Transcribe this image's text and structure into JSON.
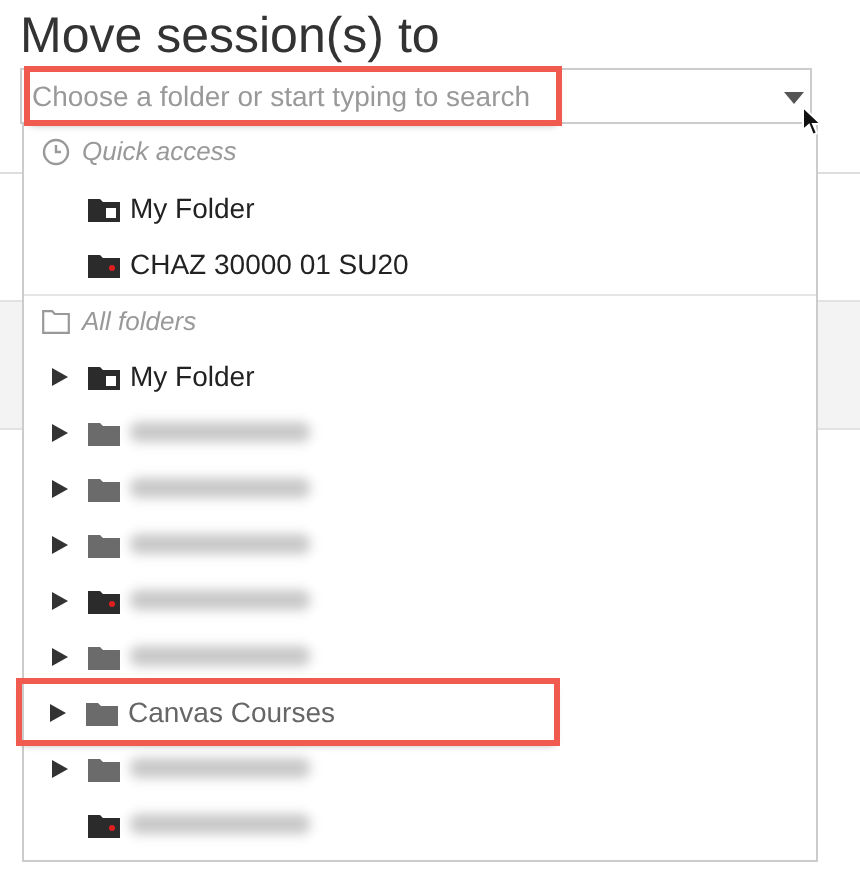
{
  "title": "Move session(s) to",
  "search": {
    "placeholder": "Choose a folder or start typing to search",
    "highlighted": true
  },
  "quick_access": {
    "heading": "Quick access",
    "items": [
      {
        "label": "My Folder",
        "kind": "personal"
      },
      {
        "label": "CHAZ 30000 01 SU20",
        "kind": "course"
      }
    ]
  },
  "all_folders": {
    "heading": "All folders",
    "items": [
      {
        "label": "My Folder",
        "kind": "personal",
        "expandable": true,
        "blurred": false,
        "highlighted": false
      },
      {
        "kind": "plain",
        "expandable": true,
        "blurred": true,
        "highlighted": false
      },
      {
        "kind": "plain",
        "expandable": true,
        "blurred": true,
        "highlighted": false
      },
      {
        "kind": "plain",
        "expandable": true,
        "blurred": true,
        "highlighted": false
      },
      {
        "kind": "course",
        "expandable": true,
        "blurred": true,
        "highlighted": false
      },
      {
        "kind": "plain",
        "expandable": true,
        "blurred": true,
        "highlighted": false
      },
      {
        "label": "Canvas Courses",
        "kind": "plain",
        "expandable": true,
        "blurred": false,
        "highlighted": true
      },
      {
        "kind": "plain",
        "expandable": true,
        "blurred": true,
        "highlighted": false
      },
      {
        "kind": "course",
        "expandable": false,
        "blurred": true,
        "highlighted": false
      }
    ]
  }
}
